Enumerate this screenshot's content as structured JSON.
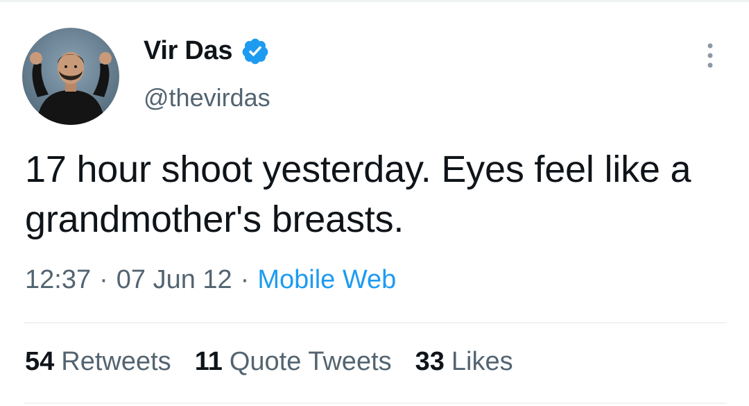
{
  "author": {
    "display_name": "Vir Das",
    "handle": "@thevirdas",
    "verified": true,
    "avatar": "avatar-photo"
  },
  "tweet": {
    "text": "17 hour shoot yesterday. Eyes feel like a grandmother's breasts."
  },
  "meta": {
    "time": "12:37",
    "separator": "·",
    "date": "07 Jun 12",
    "source": "Mobile Web"
  },
  "stats": [
    {
      "count": "54",
      "label": "Retweets"
    },
    {
      "count": "11",
      "label": "Quote Tweets"
    },
    {
      "count": "33",
      "label": "Likes"
    }
  ],
  "icons": {
    "verified": "verified-badge-icon",
    "more": "more-options-icon"
  },
  "colors": {
    "text_primary": "#0f1419",
    "text_secondary": "#536471",
    "accent_blue": "#1d9bf0",
    "divider": "#eff3f4"
  }
}
